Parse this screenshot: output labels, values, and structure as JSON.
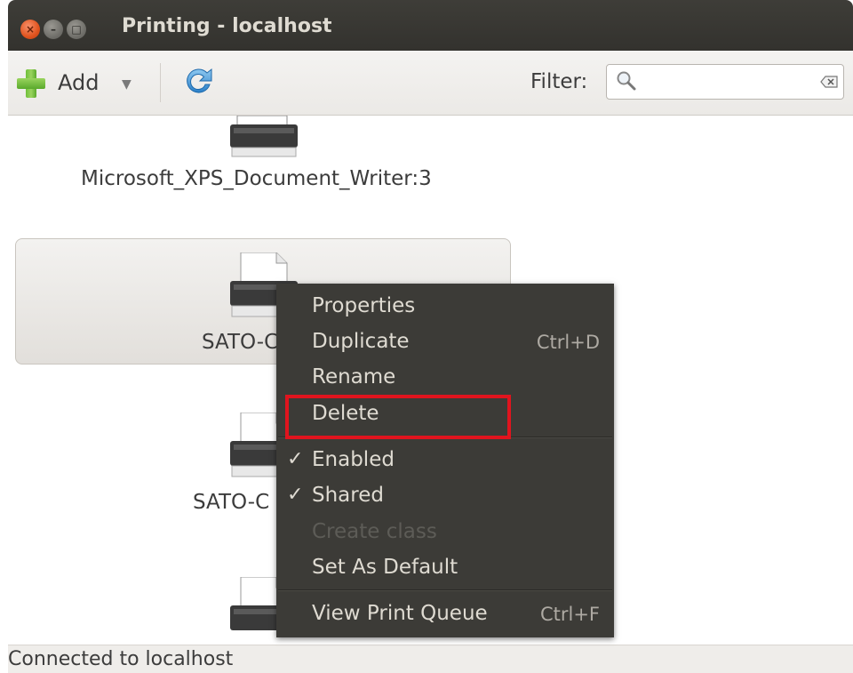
{
  "window": {
    "title": "Printing - localhost",
    "buttons": [
      "close",
      "minimize",
      "maximize"
    ],
    "close_glyph": "×",
    "min_glyph": "–",
    "max_glyph": "□"
  },
  "toolbar": {
    "add_label": "Add",
    "add_arrow": "▼",
    "refresh_icon": "refresh-icon",
    "filter_label": "Filter:",
    "filter_value": "",
    "filter_placeholder": ""
  },
  "printers": [
    {
      "name": "Microsoft_XPS_Document_Writer:3"
    },
    {
      "name": "SATO-C",
      "selected": true
    },
    {
      "name": "SATO-C"
    },
    {
      "name": ""
    }
  ],
  "context_menu": {
    "items": [
      {
        "label": "Properties",
        "shortcut": ""
      },
      {
        "label": "Duplicate",
        "shortcut": "Ctrl+D"
      },
      {
        "label": "Rename",
        "shortcut": ""
      },
      {
        "label": "Delete",
        "shortcut": "",
        "highlighted": true
      },
      {
        "label": "Enabled",
        "checked": true,
        "check_glyph": "✓"
      },
      {
        "label": "Shared",
        "checked": true,
        "check_glyph": "✓"
      },
      {
        "label": "Create class",
        "disabled": true
      },
      {
        "label": "Set As Default",
        "shortcut": ""
      },
      {
        "label": "View Print Queue",
        "shortcut": "Ctrl+F"
      }
    ]
  },
  "status": {
    "text": "Connected to localhost"
  },
  "colors": {
    "titlebar": "#3c3b37",
    "menu_bg": "#3c3b37",
    "highlight_border": "#e0141e",
    "close_button": "#e0531e"
  }
}
